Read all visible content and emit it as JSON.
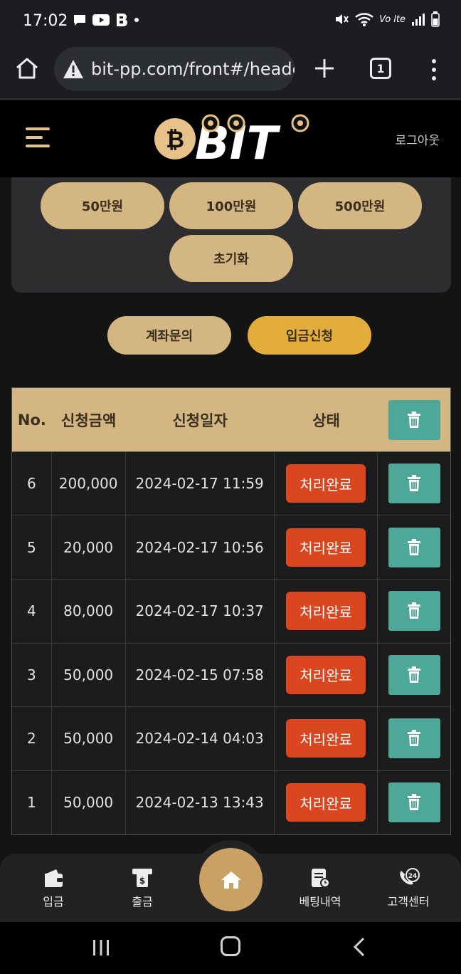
{
  "status_bar": {
    "time": "17:02",
    "carrier": "Vo lte"
  },
  "browser": {
    "url": "bit-pp.com/front#/heade",
    "tab_count": "1"
  },
  "header": {
    "logo_text": "BIT",
    "logout_label": "로그아웃"
  },
  "amount_buttons": [
    "50만원",
    "100만원",
    "500만원"
  ],
  "reset_label": "초기화",
  "actions": {
    "account_inquiry": "계좌문의",
    "deposit_request": "입금신청"
  },
  "table": {
    "headers": {
      "no": "No.",
      "amount": "신청금액",
      "date": "신청일자",
      "status": "상태"
    },
    "rows": [
      {
        "no": "6",
        "amount": "200,000",
        "date": "2024-02-17 11:59",
        "status": "처리완료"
      },
      {
        "no": "5",
        "amount": "20,000",
        "date": "2024-02-17 10:56",
        "status": "처리완료"
      },
      {
        "no": "4",
        "amount": "80,000",
        "date": "2024-02-17 10:37",
        "status": "처리완료"
      },
      {
        "no": "3",
        "amount": "50,000",
        "date": "2024-02-15 07:58",
        "status": "처리완료"
      },
      {
        "no": "2",
        "amount": "50,000",
        "date": "2024-02-14 04:03",
        "status": "처리완료"
      },
      {
        "no": "1",
        "amount": "50,000",
        "date": "2024-02-13 13:43",
        "status": "처리완료"
      }
    ]
  },
  "bottom_nav": {
    "deposit": "입금",
    "withdraw": "출금",
    "betting_history": "베팅내역",
    "customer_center": "고객센터"
  },
  "colors": {
    "gold": "#d4b682",
    "gold_active": "#e3ad3c",
    "status_red": "#d9461f",
    "delete_teal": "#4ea89a"
  }
}
